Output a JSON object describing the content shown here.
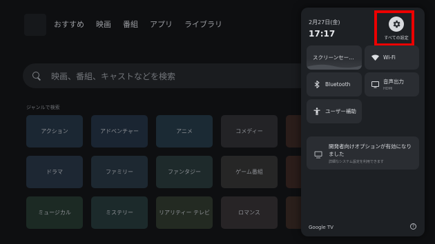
{
  "nav": {
    "items": [
      "おすすめ",
      "映画",
      "番組",
      "アプリ",
      "ライブラリ"
    ]
  },
  "search": {
    "placeholder": "映画、番組、キャストなどを検索"
  },
  "genres": {
    "heading": "ジャンルで検索",
    "tiles": [
      {
        "label": "アクション",
        "color": "#1b2733"
      },
      {
        "label": "アドベンチャー",
        "color": "#1a2532"
      },
      {
        "label": "アニメ",
        "color": "#1b2a34"
      },
      {
        "label": "コメディー",
        "color": "#232326"
      },
      {
        "label": "",
        "color": "#2a1d1a"
      },
      {
        "label": "ドラマ",
        "color": "#1d2733"
      },
      {
        "label": "ファミリー",
        "color": "#1d2831"
      },
      {
        "label": "ファンタジー",
        "color": "#1e2a2b"
      },
      {
        "label": "ゲーム番組",
        "color": "#262626"
      },
      {
        "label": "",
        "color": "#2b1d1a"
      },
      {
        "label": "ミュージカル",
        "color": "#1c2a24"
      },
      {
        "label": "ミステリー",
        "color": "#1c2a2b"
      },
      {
        "label": "リアリティー テレビ",
        "color": "#232a22"
      },
      {
        "label": "ロマンス",
        "color": "#272426"
      },
      {
        "label": "",
        "color": "#2a1f1b"
      }
    ]
  },
  "quick_settings": {
    "date": "2月27日(金)",
    "time": "17:17",
    "all_settings_label": "すべての設定",
    "tiles": {
      "screensaver": "スクリーンセー…",
      "wifi": "Wi-Fi",
      "bluetooth": "Bluetooth",
      "audio": "音声出力",
      "audio_sub": "HDMI",
      "user_assist": "ユーザー補助"
    },
    "dev_card": {
      "title": "開発者向けオプションが有効になりました",
      "subtitle": "詳細なシステム設定を利用できます"
    },
    "brand": "Google TV",
    "help_glyph": "?"
  },
  "colors": {
    "highlight": "#ec0000",
    "panel": "#1d2024",
    "tile": "#2a2d32"
  }
}
